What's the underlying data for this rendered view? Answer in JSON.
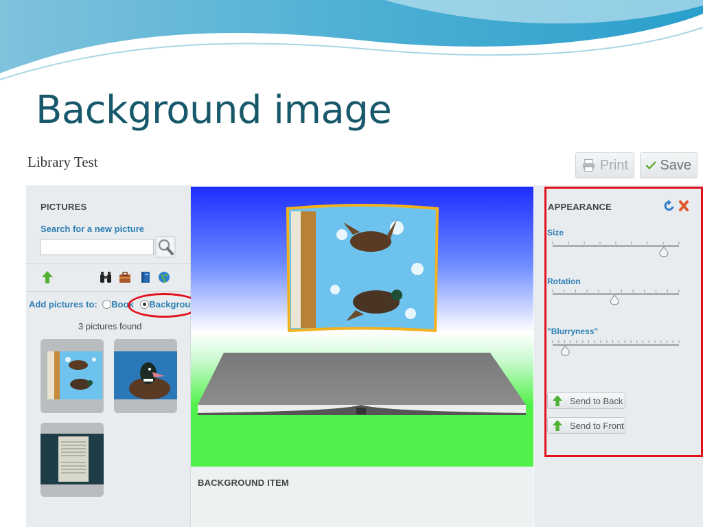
{
  "slide": {
    "title": "Background image"
  },
  "app": {
    "name": "Library Test",
    "print_label": "Print",
    "save_label": "Save"
  },
  "left_panel": {
    "section_title": "PICTURES",
    "search_link": "Search for a new picture",
    "search_value": "",
    "add_to_label": "Add pictures to:",
    "options": [
      "Book",
      "Background"
    ],
    "selected_option": "Background",
    "found_count": "3 pictures found",
    "icons": [
      "up-arrow-icon",
      "binoculars-icon",
      "briefcase-icon",
      "book-icon",
      "globe-icon"
    ]
  },
  "bottom_panel": {
    "title": "BACKGROUND ITEM"
  },
  "right_panel": {
    "title": "APPEARANCE",
    "sliders": [
      {
        "label": "Size",
        "value": 0.88
      },
      {
        "label": "Rotation",
        "value": 0.49
      },
      {
        "label": "\"Blurryness\"",
        "value": 0.1
      }
    ],
    "send_back_label": "Send to Back",
    "send_front_label": "Send to Front"
  },
  "colors": {
    "title": "#17586b",
    "link": "#2e7fb5",
    "highlight": "#e2101b",
    "sky_top": "#1c2dff",
    "grass": "#52f04a",
    "frame": "#f2b21e"
  }
}
